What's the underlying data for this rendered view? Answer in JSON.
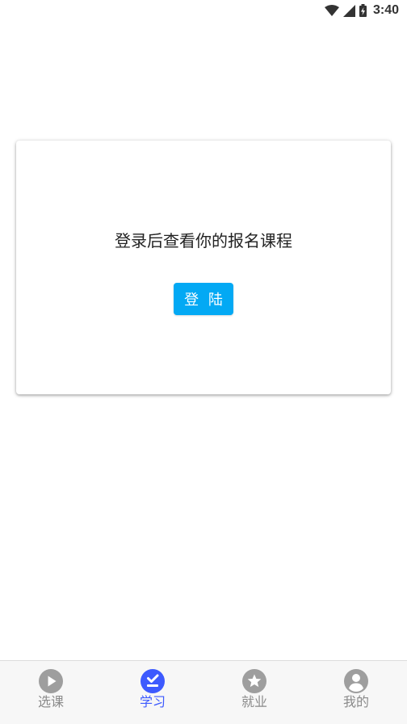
{
  "status_bar": {
    "time": "3:40",
    "icons": [
      "wifi-icon",
      "cellular-signal-icon",
      "battery-charging-icon"
    ]
  },
  "card": {
    "message": "登录后查看你的报名课程",
    "login_button_label": "登 陆"
  },
  "bottom_nav": {
    "items": [
      {
        "label": "选课",
        "icon": "play-circle-icon",
        "active": false
      },
      {
        "label": "学习",
        "icon": "check-circle-icon",
        "active": true
      },
      {
        "label": "就业",
        "icon": "star-circle-icon",
        "active": false
      },
      {
        "label": "我的",
        "icon": "account-circle-icon",
        "active": false
      }
    ]
  },
  "colors": {
    "accent": "#03a9f4",
    "nav_active": "#3d5afe",
    "nav_inactive": "#9e9e9e",
    "nav_label_inactive": "#8a8a8a"
  }
}
